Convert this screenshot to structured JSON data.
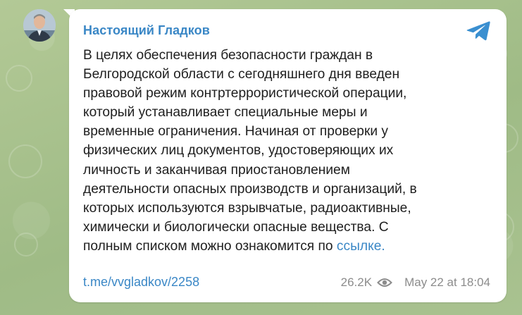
{
  "channel": {
    "name": "Настоящий Гладков"
  },
  "message": {
    "text": "В целях обеспечения безопасности граждан в\nБелгородской области с сегодняшнего дня введен\nправовой режим контртеррористической операции,\nкоторый устанавливает специальные меры и\nвременные ограничения. Начиная от проверки у\nфизических лиц документов, удостоверяющих их\nличность и заканчивая приостановлением\nдеятельности опасных производств и организаций, в\nкоторых используются взрывчатые, радиоактивные,\nхимически и биологически опасные вещества. С\nполным списком можно ознакомится по ",
    "link_text": "ссылке.",
    "post_link": "t.me/vvgladkov/2258",
    "views": "26.2K",
    "timestamp": "May 22 at 18:04"
  },
  "icons": {
    "app": "telegram-icon",
    "views": "eye-icon"
  },
  "colors": {
    "accent": "#3a87c6",
    "meta": "#8c8c8c",
    "text": "#202020",
    "background": "#a7c08f",
    "bubble": "#ffffff"
  }
}
